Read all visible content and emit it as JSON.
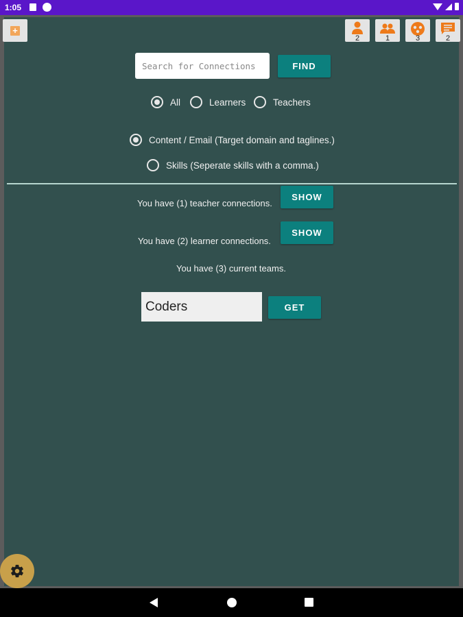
{
  "status": {
    "time": "1:05"
  },
  "toolbar": {
    "add_label": "+",
    "counts": {
      "person": "2",
      "people": "1",
      "team": "3",
      "messages": "2"
    }
  },
  "search": {
    "placeholder": "Search for Connections",
    "value": "",
    "find_label": "FIND"
  },
  "filter": {
    "all": "All",
    "learners": "Learners",
    "teachers": "Teachers",
    "selected": "All"
  },
  "mode": {
    "content": "Content / Email (Target domain and taglines.)",
    "skills": "Skills (Seperate skills with a comma.)",
    "selected": "content"
  },
  "connections": {
    "teacher_text": "You have (1) teacher connections.",
    "learner_text": "You have (2) learner connections.",
    "teams_text": "You have (3) current teams.",
    "show_label": "SHOW"
  },
  "team_search": {
    "value": "Coders",
    "get_label": "GET"
  },
  "colors": {
    "accent": "#0c807e",
    "panel": "#32504e",
    "icon_orange": "#ee7a1a",
    "fab": "#c8a04a",
    "statusbar": "#5a16c9"
  }
}
